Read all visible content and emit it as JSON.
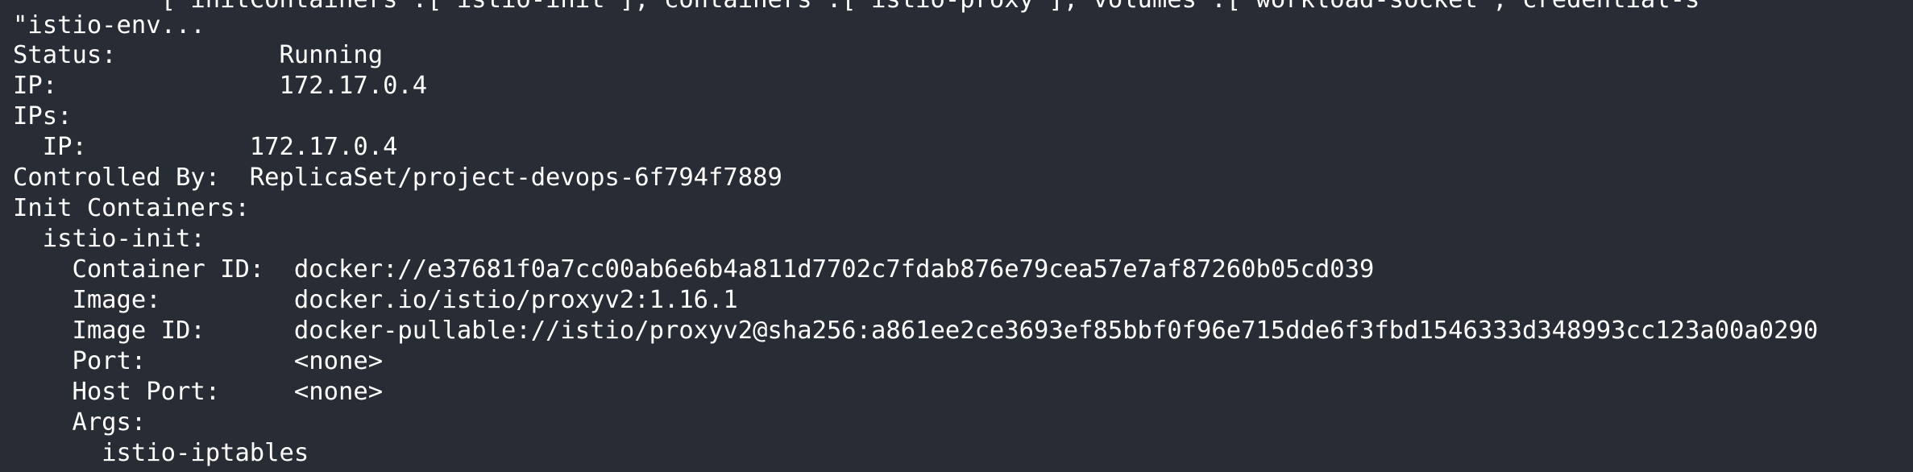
{
  "terminal": {
    "lines": [
      "          [\"initContainers\":[\"istio-init\"],\"containers\":[\"istio-proxy\"],\"volumes\":[\"workload-socket\",\"credential-s",
      "\"istio-env...",
      "Status:           Running",
      "IP:               172.17.0.4",
      "IPs:",
      "  IP:           172.17.0.4",
      "Controlled By:  ReplicaSet/project-devops-6f794f7889",
      "Init Containers:",
      "  istio-init:",
      "    Container ID:  docker://e37681f0a7cc00ab6e6b4a811d7702c7fdab876e79cea57e7af87260b05cd039",
      "    Image:         docker.io/istio/proxyv2:1.16.1",
      "    Image ID:      docker-pullable://istio/proxyv2@sha256:a861ee2ce3693ef85bbf0f96e715dde6f3fbd1546333d348993cc123a00a0290",
      "    Port:          <none>",
      "    Host Port:     <none>",
      "    Args:",
      "      istio-iptables"
    ]
  }
}
